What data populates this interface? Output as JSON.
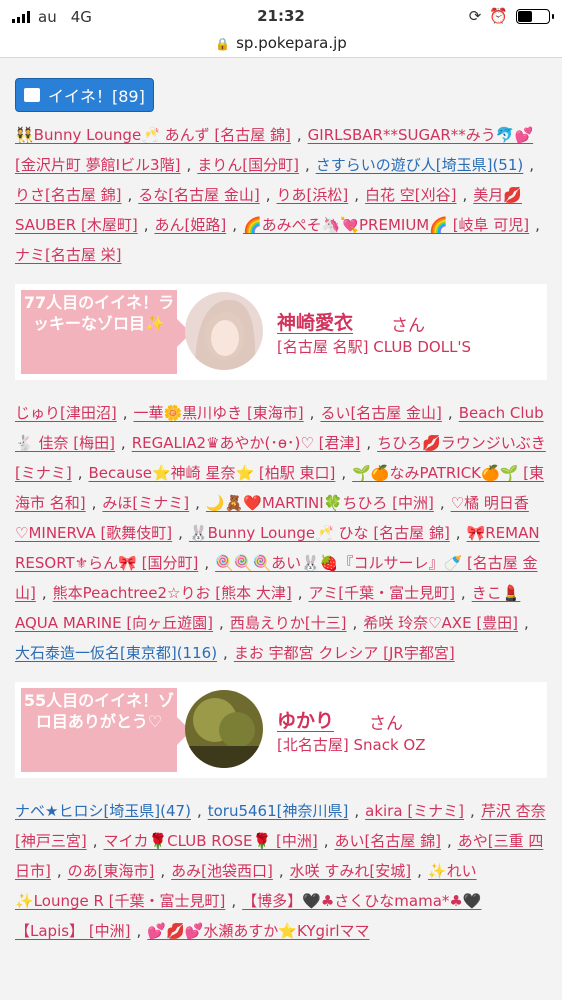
{
  "status": {
    "carrier": "au",
    "network": "4G",
    "time": "21:32"
  },
  "url": "sp.pokepara.jp",
  "iine_button": "イイネ！[89]",
  "block1": [
    {
      "t": "👯Bunny Lounge🥂 あんず [名古屋 錦]",
      "c": "pink"
    },
    {
      "t": "GIRLSBAR**SUGAR**みう🐬💕 [金沢片町 夢館Ⅰビル3階]",
      "c": "pink"
    },
    {
      "t": "まりん[国分町]",
      "c": "pink"
    },
    {
      "t": "さすらいの遊び人[埼玉県](51)",
      "c": "blue"
    },
    {
      "t": "りさ[名古屋 錦]",
      "c": "pink"
    },
    {
      "t": "るな[名古屋 金山]",
      "c": "pink"
    },
    {
      "t": "りあ[浜松]",
      "c": "pink"
    },
    {
      "t": "白花 空[刈谷]",
      "c": "pink"
    },
    {
      "t": "美月💋SAUBER [木屋町]",
      "c": "pink"
    },
    {
      "t": "あん[姫路]",
      "c": "pink"
    },
    {
      "t": "🌈あみぺそ🦄💘PREMIUM🌈 [岐阜 可児]",
      "c": "pink"
    },
    {
      "t": "ナミ[名古屋 栄]",
      "c": "pink"
    }
  ],
  "card1": {
    "banner": "77人目のイイネ！ラッキーなゾロ目✨",
    "name": "神崎愛衣",
    "san": "さん",
    "shop": "[名古屋 名駅] CLUB DOLL'S"
  },
  "block2": [
    {
      "t": "じゅり[津田沼]",
      "c": "pink"
    },
    {
      "t": "一華🌼黒川ゆき [東海市]",
      "c": "pink"
    },
    {
      "t": "るい[名古屋 金山]",
      "c": "pink"
    },
    {
      "t": "Beach Club 🐇 佳奈 [梅田]",
      "c": "pink"
    },
    {
      "t": "REGALIA2♛あやか(･ө･)♡ [君津]",
      "c": "pink"
    },
    {
      "t": "ちひろ💋ラウンジいぶき [ミナミ]",
      "c": "pink"
    },
    {
      "t": "Because⭐神崎 星奈⭐ [柏駅 東口]",
      "c": "pink"
    },
    {
      "t": "🌱🍊なみPATRICK🍊🌱 [東海市 名和]",
      "c": "pink"
    },
    {
      "t": "みほ[ミナミ]",
      "c": "pink"
    },
    {
      "t": "🌙🧸❤️MARTINI🍀ちひろ [中洲]",
      "c": "pink"
    },
    {
      "t": "♡橘 明日香♡MINERVA [歌舞伎町]",
      "c": "pink"
    },
    {
      "t": "🐰Bunny Lounge🥂 ひな [名古屋 錦]",
      "c": "pink"
    },
    {
      "t": "🎀REMAN RESORT⚜らん🎀 [国分町]",
      "c": "pink"
    },
    {
      "t": "🍭🍭🍭あい🐰🍓『コルサーレ』🍼 [名古屋 金山]",
      "c": "pink"
    },
    {
      "t": "熊本Peachtree2☆りお [熊本 大津]",
      "c": "pink"
    },
    {
      "t": "アミ[千葉・富士見町]",
      "c": "pink"
    },
    {
      "t": "きこ💄AQUA MARINE [向ヶ丘遊園]",
      "c": "pink"
    },
    {
      "t": "西島えりか[十三]",
      "c": "pink"
    },
    {
      "t": "希咲 玲奈♡AXE [豊田]",
      "c": "pink"
    },
    {
      "t": "大石泰造一仮名[東京都](116)",
      "c": "blue"
    },
    {
      "t": "まお 宇都宮 クレシア [JR宇都宮]",
      "c": "pink"
    }
  ],
  "card2": {
    "banner": "55人目のイイネ！ゾロ目ありがとう♡",
    "name": "ゆかり",
    "san": "さん",
    "shop": "[北名古屋] Snack OZ"
  },
  "block3": [
    {
      "t": "ナベ★ヒロシ[埼玉県](47)",
      "c": "blue"
    },
    {
      "t": "toru5461[神奈川県]",
      "c": "blue"
    },
    {
      "t": "akira [ミナミ]",
      "c": "pink"
    },
    {
      "t": "芹沢 杏奈[神戸三宮]",
      "c": "pink"
    },
    {
      "t": "マイカ🌹CLUB ROSE🌹 [中洲]",
      "c": "pink"
    },
    {
      "t": "あい[名古屋 錦]",
      "c": "pink"
    },
    {
      "t": "あや[三重 四日市]",
      "c": "pink"
    },
    {
      "t": "のあ[東海市]",
      "c": "pink"
    },
    {
      "t": "あみ[池袋西口]",
      "c": "pink"
    },
    {
      "t": "水咲 すみれ[安城]",
      "c": "pink"
    },
    {
      "t": "✨れい✨Lounge R [千葉・富士見町]",
      "c": "pink"
    },
    {
      "t": "【博多】🖤♣さくひなmama*♣🖤 【Lapis】 [中洲]",
      "c": "pink"
    },
    {
      "t": "💕💋💕水瀬あすか⭐KYgirlママ",
      "c": "pink"
    }
  ]
}
